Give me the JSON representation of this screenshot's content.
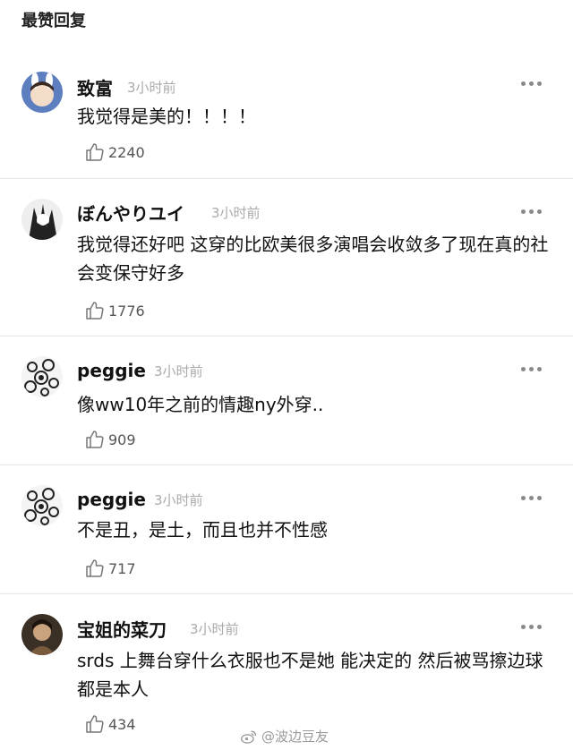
{
  "section_title": "最赞回复",
  "comments": [
    {
      "author": "致富",
      "time": "3小时前",
      "text": "我觉得是美的！！！！",
      "likes": "2240"
    },
    {
      "author": "ぼんやりユイ",
      "time": "3小时前",
      "text": "我觉得还好吧 这穿的比欧美很多演唱会收敛多了现在真的社会变保守好多",
      "likes": "1776"
    },
    {
      "author": "peggie",
      "time": "3小时前",
      "text": "像ww10年之前的情趣ny外穿..",
      "likes": "909"
    },
    {
      "author": "peggie",
      "time": "3小时前",
      "text": "不是丑，是土，而且也并不性感",
      "likes": "717"
    },
    {
      "author": "宝姐的菜刀",
      "time": "3小时前",
      "text": "srds 上舞台穿什么衣服也不是她 能决定的 然后被骂擦边球都是本人",
      "likes": "434"
    }
  ],
  "watermark": "@波边豆友",
  "icons": {
    "more": "more-dots-icon",
    "like": "thumbs-up-icon",
    "watermark": "weibo-logo-icon"
  },
  "colors": {
    "text": "#111111",
    "secondary": "#aaaaaa",
    "divider": "#e6e6e6",
    "icon": "#888888"
  }
}
